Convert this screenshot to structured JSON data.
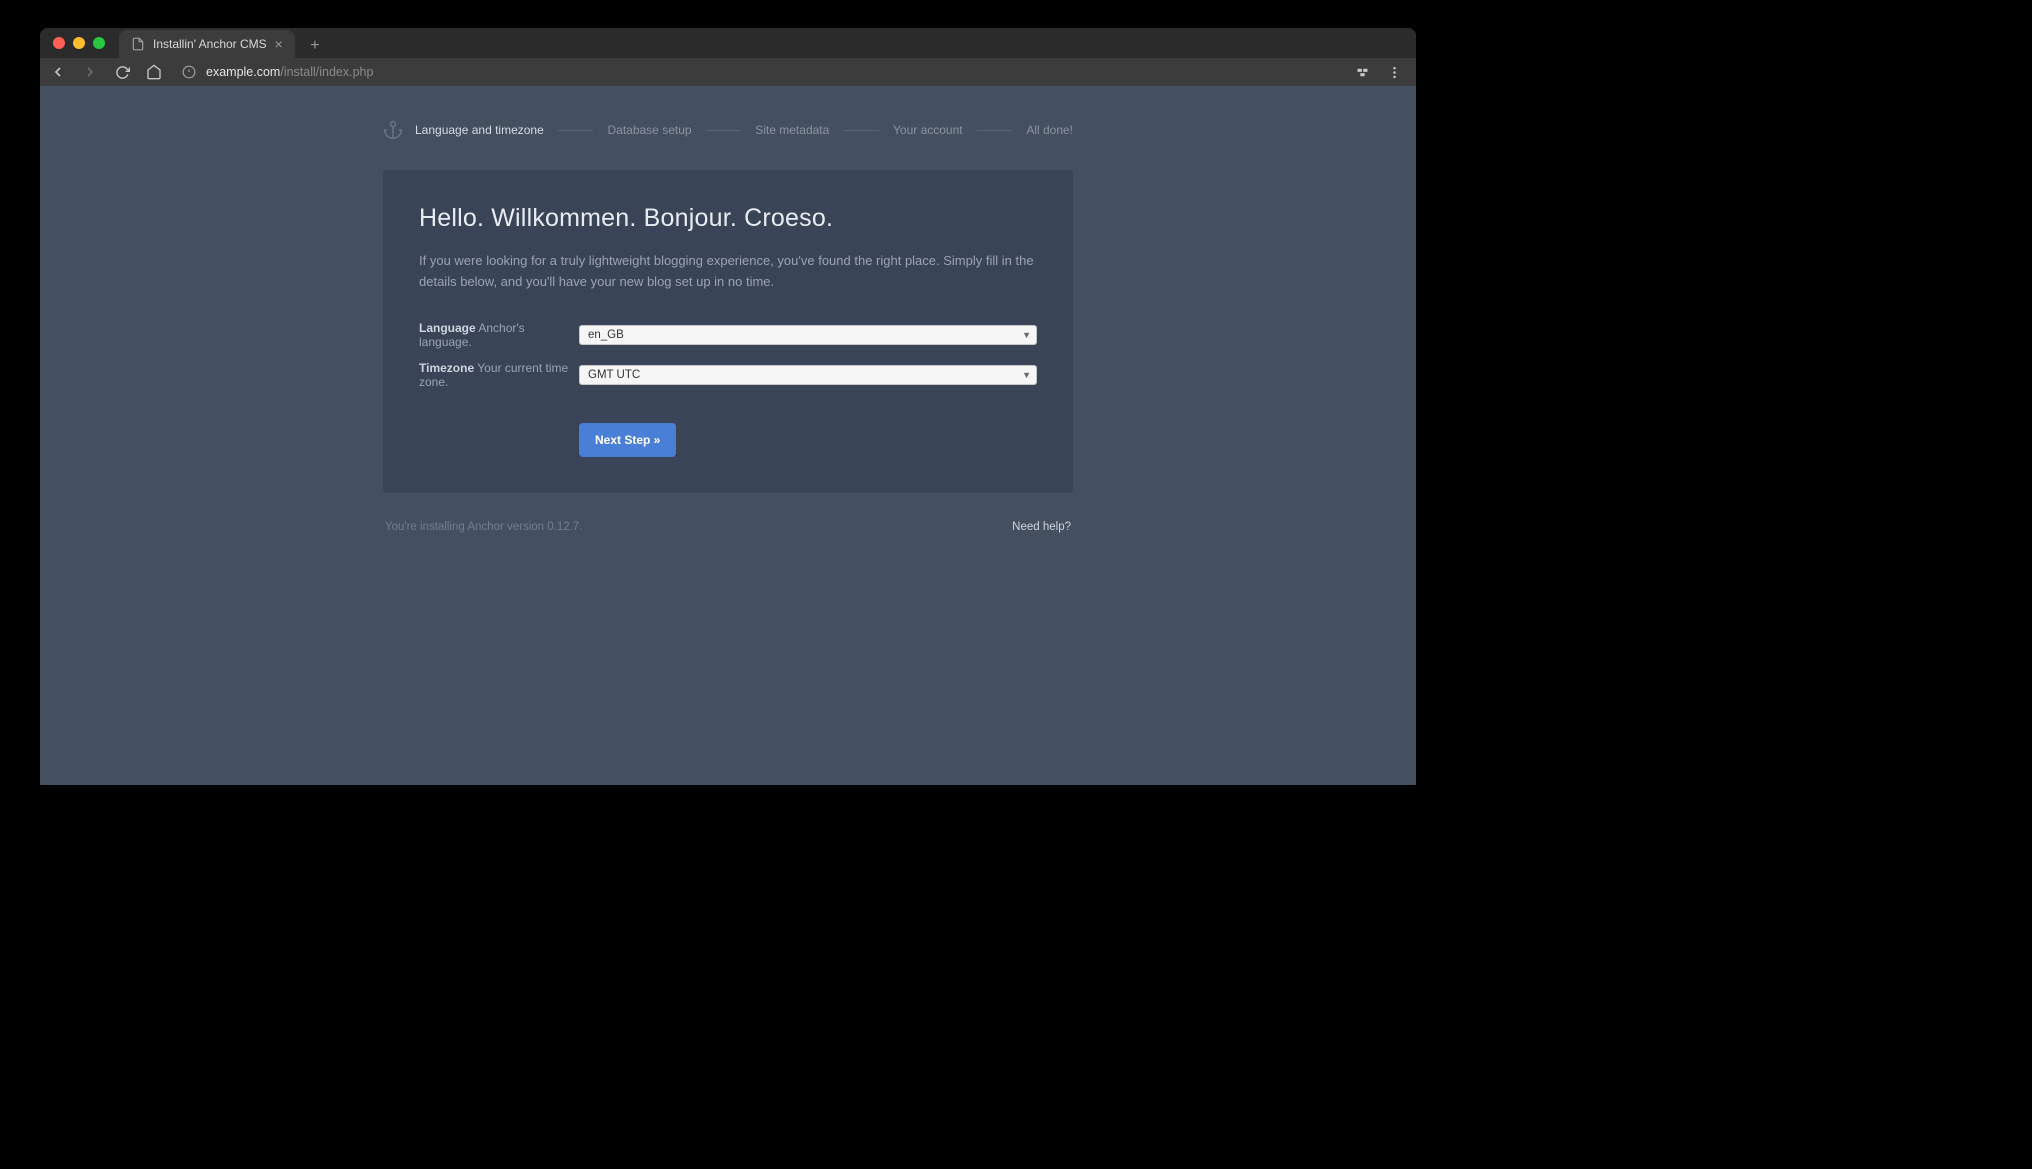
{
  "browser": {
    "tab_title": "Installin' Anchor CMS",
    "url_domain": "example.com",
    "url_path": "/install/index.php"
  },
  "steps": [
    "Language and timezone",
    "Database setup",
    "Site metadata",
    "Your account",
    "All done!"
  ],
  "card": {
    "heading": "Hello. Willkommen. Bonjour. Croeso.",
    "intro": "If you were looking for a truly lightweight blogging experience, you've found the right place. Simply fill in the details below, and you'll have your new blog set up in no time."
  },
  "fields": {
    "language": {
      "label": "Language",
      "hint": "Anchor's language.",
      "value": "en_GB"
    },
    "timezone": {
      "label": "Timezone",
      "hint": "Your current time zone.",
      "value": "GMT UTC"
    }
  },
  "actions": {
    "next": "Next Step »"
  },
  "footer": {
    "version": "You're installing Anchor version 0.12.7.",
    "help": "Need help?"
  }
}
